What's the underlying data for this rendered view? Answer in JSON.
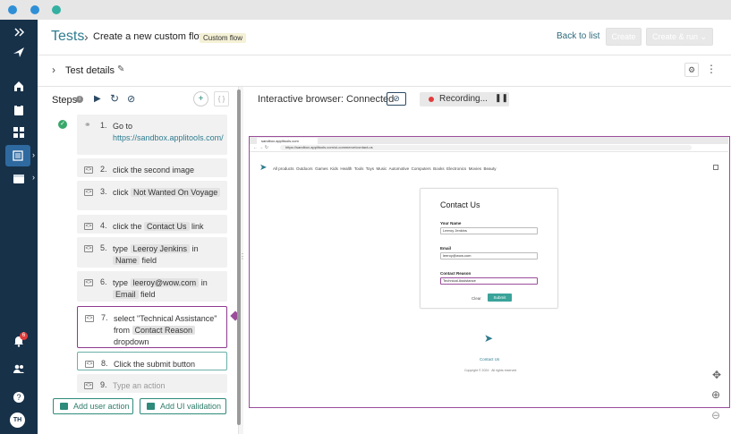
{
  "header": {
    "breadcrumb_root": "Tests",
    "breadcrumb_sep": "›",
    "title": "Create a new custom flow",
    "badge": "Custom flow",
    "back_label": "Back to list",
    "create_label": "Create",
    "create_run_label": "Create & run"
  },
  "subheader": {
    "title": "Test details"
  },
  "steps": {
    "label": "Steps",
    "items": [
      {
        "num": "1.",
        "parts": [
          "Go to ",
          "https://sandbox.applitools.com/"
        ]
      },
      {
        "num": "2.",
        "text": "click the second image"
      },
      {
        "num": "3.",
        "pre": "click ",
        "chip": "Not Wanted On Voyage"
      },
      {
        "num": "4.",
        "pre": "click the ",
        "chip": "Contact Us",
        "post": " link"
      },
      {
        "num": "5.",
        "pre": "type ",
        "chip": "Leeroy Jenkins",
        "mid": " in ",
        "chip2": "Name",
        "post": " field"
      },
      {
        "num": "6.",
        "pre": "type ",
        "chip": "leeroy@wow.com",
        "mid": " in ",
        "chip2": "Email",
        "post": " field"
      },
      {
        "num": "7.",
        "pre": "select \"Technical Assistance\" from ",
        "chip": "Contact Reason",
        "post": " dropdown"
      },
      {
        "num": "8.",
        "text": "Click the submit button"
      },
      {
        "num": "9.",
        "placeholder": "Type an action"
      }
    ],
    "add_user_action": "Add user action",
    "add_ui_validation": "Add UI validation"
  },
  "browser": {
    "label_prefix": "Interactive browser: ",
    "status": "Connected",
    "recording": "Recording...",
    "tab_title": "sandbox.applitools.com",
    "url": "https://sandbox.applitools.com/ui-commerce/contact-us",
    "site_nav": [
      "All products",
      "Outdoors",
      "Games",
      "Kids",
      "Health",
      "Tools",
      "Toys",
      "Music",
      "Automotive",
      "Computers",
      "Books",
      "Electronics",
      "Movies",
      "Beauty"
    ],
    "form": {
      "title": "Contact Us",
      "name_label": "Your Name",
      "name_value": "Leeroy Jenkins",
      "email_label": "Email",
      "email_value": "leeroy@wow.com",
      "reason_label": "Contact Reason",
      "reason_value": "Technical Assistance",
      "clear": "Clear",
      "submit": "Submit"
    },
    "footer_link": "Contact Us",
    "copyright": "Copyright © 2024 · All rights reserved"
  },
  "sidebar": {
    "avatar": "TH",
    "notifications": "6"
  },
  "colors": {
    "sidebar": "#173149",
    "accent": "#2e7c8f",
    "selected_border": "#8e3a8e"
  }
}
